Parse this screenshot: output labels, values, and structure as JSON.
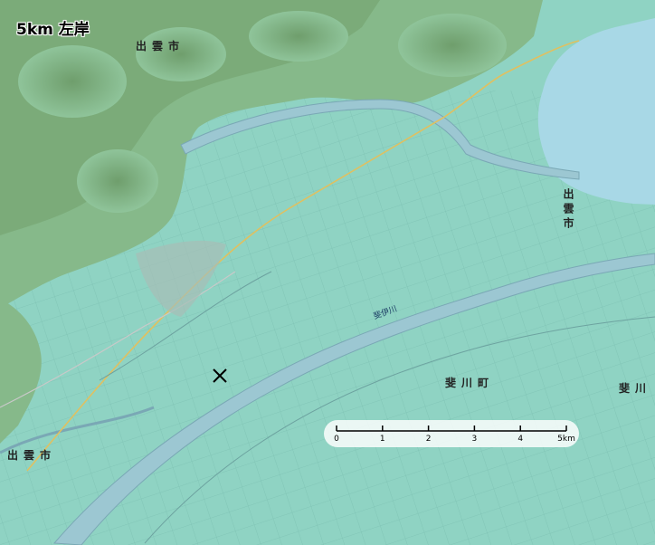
{
  "map": {
    "title": "5km 左岸",
    "place_labels": {
      "izumo_north": "出雲市",
      "izumo_east": "出雲市",
      "izumo_southwest": "出雲市",
      "hikawa": "斐川町",
      "hikawa_edge": "斐川"
    },
    "river_label": "斐伊川",
    "marker_icon": "x-mark-icon",
    "colors": {
      "plain": "#8fd3c3",
      "mountain": "#7fb383",
      "lake": "#a8d8e6",
      "river": "#9cc7d2",
      "road": "#e0c060",
      "scale_bg": "#ffffff"
    }
  },
  "scale": {
    "ticks": [
      "0",
      "1",
      "2",
      "3",
      "4",
      "5km"
    ]
  }
}
